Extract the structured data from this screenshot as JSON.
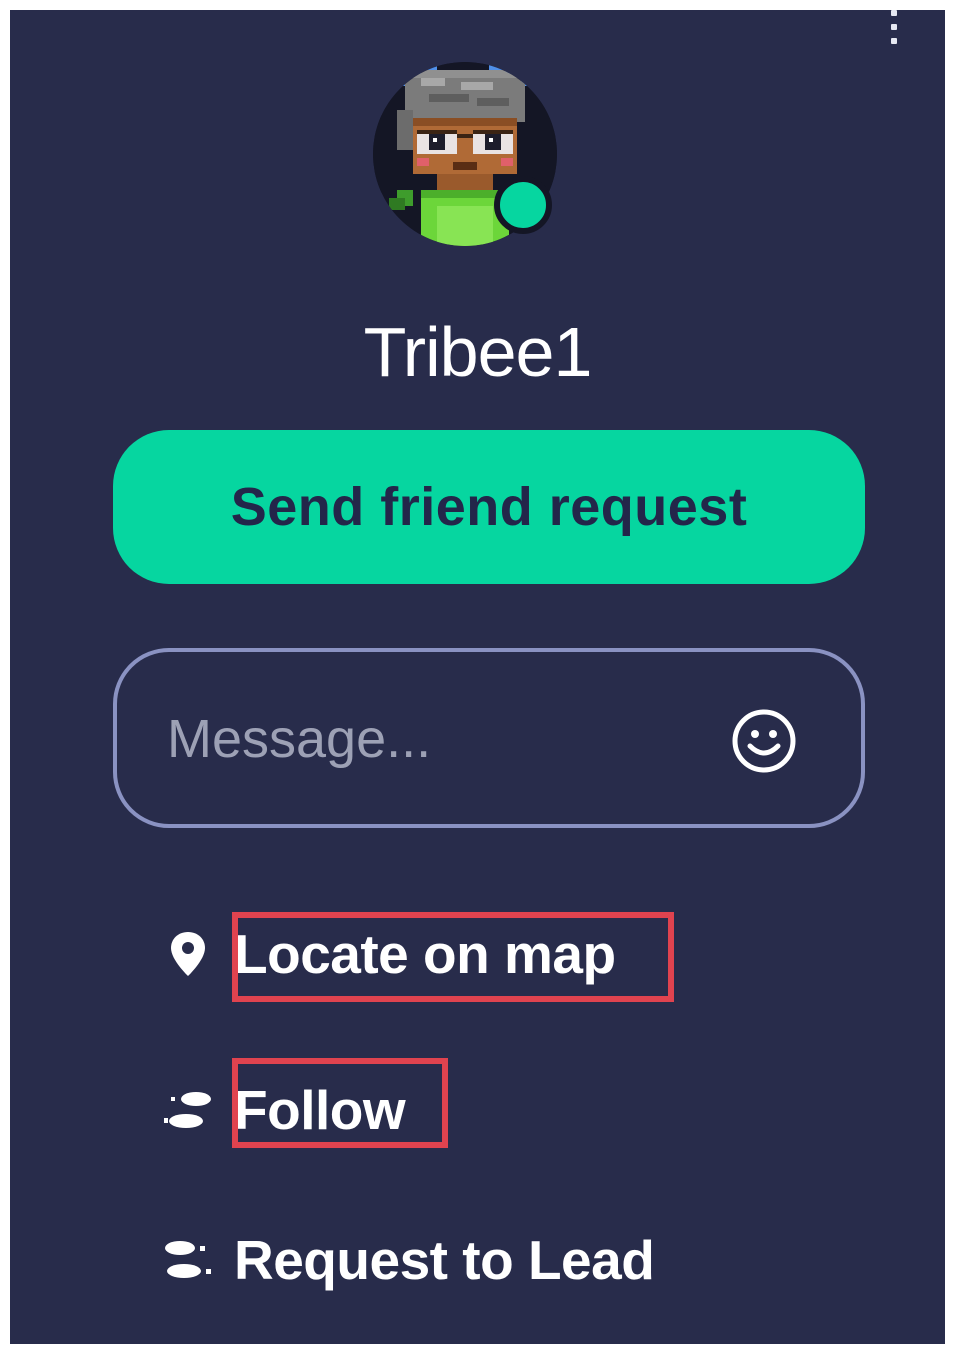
{
  "profile": {
    "username": "Tribee1",
    "status": "online"
  },
  "actions": {
    "friend_request_label": "Send friend request",
    "message_placeholder": "Message...",
    "locate_label": "Locate on map",
    "follow_label": "Follow",
    "lead_label": "Request to Lead"
  },
  "icons": {
    "menu": "more-vertical-icon",
    "emoji": "smiley-icon",
    "locate": "map-pin-icon",
    "follow": "footsteps-icon",
    "lead": "lead-icon"
  },
  "colors": {
    "panel_bg": "#282c4b",
    "accent": "#06d6a0",
    "button_text": "#23264a",
    "input_border": "#8a92c2",
    "highlight": "#e0434f"
  }
}
